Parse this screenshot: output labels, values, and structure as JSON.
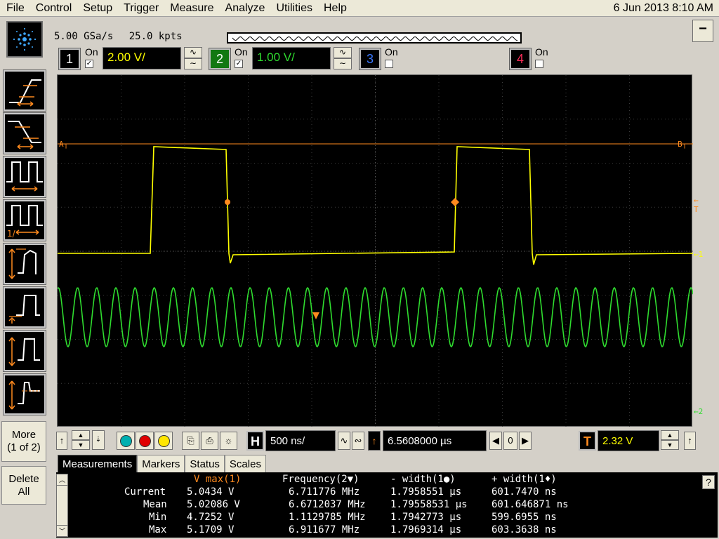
{
  "menu": [
    "File",
    "Control",
    "Setup",
    "Trigger",
    "Measure",
    "Analyze",
    "Utilities",
    "Help"
  ],
  "datetime": "6 Jun 2013  8:10 AM",
  "acquisition": {
    "sample_rate": "5.00 GSa/s",
    "memory": "25.0 kpts"
  },
  "channels": [
    {
      "num": "1",
      "on_label": "On",
      "checked": true,
      "scale": "2.00 V/",
      "color": "#ffff00"
    },
    {
      "num": "2",
      "on_label": "On",
      "checked": true,
      "scale": "1.00 V/",
      "color": "#2fdc2f"
    },
    {
      "num": "3",
      "on_label": "On",
      "checked": false,
      "color": "#3a78ff"
    },
    {
      "num": "4",
      "on_label": "On",
      "checked": false,
      "color": "#ff2d5a"
    }
  ],
  "coupling": {
    "ac": "∿",
    "dc": "∼"
  },
  "markers": {
    "a": "A",
    "b": "B",
    "t": "T",
    "ch1_ground": "1",
    "ch2_ground": "2"
  },
  "sidebar": {
    "more_line1": "More",
    "more_line2": "(1 of 2)",
    "delete_line1": "Delete",
    "delete_line2": "All"
  },
  "controls": {
    "horiz_label": "H",
    "timebase": "500 ns/",
    "delay": "6.5608000 µs",
    "ref": "0",
    "trigger_label": "T",
    "trigger_level": "2.32 V"
  },
  "tabs": [
    "Measurements",
    "Markers",
    "Status",
    "Scales"
  ],
  "measurements": {
    "headers": [
      "V max(1)",
      "Frequency(2▼)",
      "- width(1●)",
      "+ width(1♦)"
    ],
    "rows": [
      {
        "label": "Current",
        "values": [
          "5.0434 V",
          "6.711776 MHz",
          "1.7958551 µs",
          "601.7470 ns"
        ]
      },
      {
        "label": "Mean",
        "values": [
          "5.02086 V",
          "6.6712037 MHz",
          "1.79558531 µs",
          "601.646871 ns"
        ]
      },
      {
        "label": "Min",
        "values": [
          "4.7252 V",
          "1.1129785 MHz",
          "1.7942773 µs",
          "599.6955 ns"
        ]
      },
      {
        "label": "Max",
        "values": [
          "5.1709 V",
          "6.911677 MHz",
          "1.7969314 µs",
          "603.3638 ns"
        ]
      }
    ]
  },
  "help": "?",
  "colors": {
    "ch1": "#ffff00",
    "ch2": "#2fdc2f",
    "marker": "#ff8a1e",
    "grid": "#4a4a4a"
  }
}
